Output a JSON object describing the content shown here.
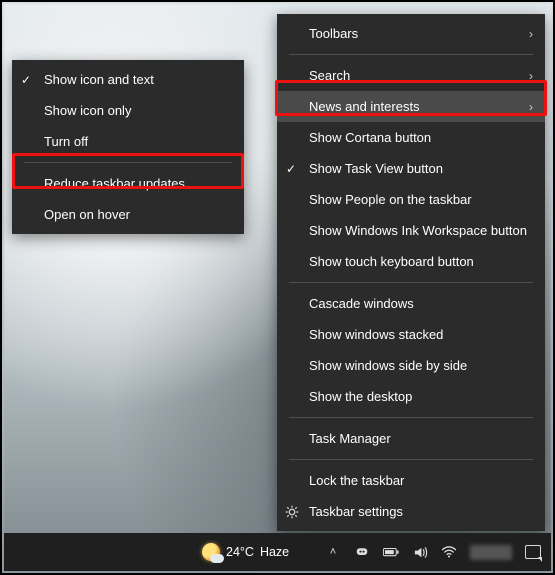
{
  "main_menu": {
    "groups": [
      [
        {
          "label": "Toolbars",
          "submenu": true
        }
      ],
      [
        {
          "label": "Search",
          "submenu": true
        },
        {
          "label": "News and interests",
          "submenu": true,
          "selected": true
        },
        {
          "label": "Show Cortana button"
        },
        {
          "label": "Show Task View button",
          "checked": true
        },
        {
          "label": "Show People on the taskbar"
        },
        {
          "label": "Show Windows Ink Workspace button"
        },
        {
          "label": "Show touch keyboard button"
        }
      ],
      [
        {
          "label": "Cascade windows"
        },
        {
          "label": "Show windows stacked"
        },
        {
          "label": "Show windows side by side"
        },
        {
          "label": "Show the desktop"
        }
      ],
      [
        {
          "label": "Task Manager"
        }
      ],
      [
        {
          "label": "Lock the taskbar"
        },
        {
          "label": "Taskbar settings",
          "icon": "gear"
        }
      ]
    ]
  },
  "sub_menu": {
    "groups": [
      [
        {
          "label": "Show icon and text",
          "checked": true
        },
        {
          "label": "Show icon only"
        },
        {
          "label": "Turn off"
        }
      ],
      [
        {
          "label": "Reduce taskbar updates"
        },
        {
          "label": "Open on hover"
        }
      ]
    ]
  },
  "taskbar": {
    "weather_temp": "24°C",
    "weather_desc": "Haze"
  }
}
